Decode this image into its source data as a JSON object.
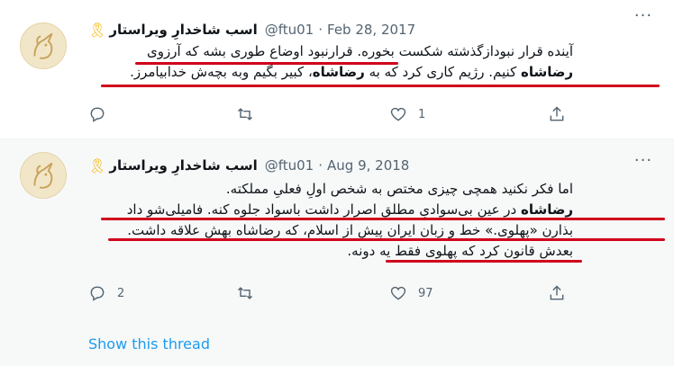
{
  "colors": {
    "accent": "#1d9bf0",
    "text": "#0f1419",
    "secondary": "#536471",
    "annotation": "#d0021b",
    "ribbon": "#f4b400"
  },
  "tweets": [
    {
      "author_name": "اسب شاخدارِ ویراستار",
      "handle": "@ftu01",
      "separator": "·",
      "date": "Feb 28, 2017",
      "ribbon_icon": "yellow-ribbon",
      "lines": [
        "آینده قرار نبودازگذشته شکست بخوره. قرارنبود اوضاع طوری بشه که آرزوی",
        {
          "bold": "رضاشاه",
          "rest_1": " کنیم. رژیم کاری کرد که به ",
          "bold_2": "رضاشاه",
          "rest_2": "، کبیر بگیم  وبه بچه‌ش خدابیامرز."
        }
      ],
      "actions": {
        "reply_count": "",
        "retweet_count": "",
        "like_count": "1"
      }
    },
    {
      "author_name": "اسب شاخدارِ ویراستار",
      "handle": "@ftu01",
      "separator": "·",
      "date": "Aug 9, 2018",
      "ribbon_icon": "yellow-ribbon",
      "lines": [
        "اما فکر نکنید همچی چیزی مختص به شخص اولِ فعلیِ مملکته.",
        {
          "bold": "رضاشاه",
          "rest": " در عینِ بی‌سوادیِ مطلق اصرار داشت باسواد جلوه کنه. فامیلی‌شو داد"
        },
        "بذارن «پهلوی.» خط و زبانِ ایرانِ پیش از اسلام، که رضاشاه بهش علاقه داشت.",
        "بعدش قانون کرد که پهلوی فقط یه دونه."
      ],
      "actions": {
        "reply_count": "2",
        "retweet_count": "",
        "like_count": "97"
      }
    }
  ],
  "show_thread": "Show this thread"
}
